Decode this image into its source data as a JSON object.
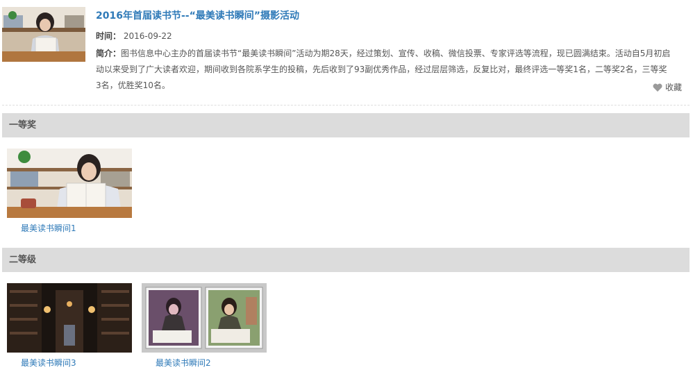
{
  "article": {
    "title": "2016年首届读书节--“最美读书瞬间”摄影活动",
    "time_label": "时间：",
    "time_value": "2016-09-22",
    "summary_label": "简介：",
    "summary_text": "图书信息中心主办的首届读书节“最美读书瞬间”活动为期28天，经过策划、宣传、收稿、微信投票、专家评选等流程，现已圆满结束。活动自5月初启动以来受到了广大读者欢迎，期间收到各院系学生的投稿，先后收到了93副优秀作品，经过层层筛选，反复比对，最终评选一等奖1名，二等奖2名，三等奖3名，优胜奖10名。",
    "favorite_label": "收藏"
  },
  "sections": [
    {
      "heading": "一等奖",
      "items": [
        {
          "caption": "最美读书瞬间1",
          "photo": "girl-reading-at-desk"
        }
      ]
    },
    {
      "heading": "二等级",
      "items": [
        {
          "caption": "最美读书瞬间3",
          "photo": "dark-library-aisle"
        },
        {
          "caption": "最美读书瞬间2",
          "photo": "two-framed-photos-reading"
        }
      ]
    }
  ],
  "colors": {
    "link": "#2f7ab8",
    "section_bar": "#dcdcdc",
    "divider": "#dddddd"
  }
}
